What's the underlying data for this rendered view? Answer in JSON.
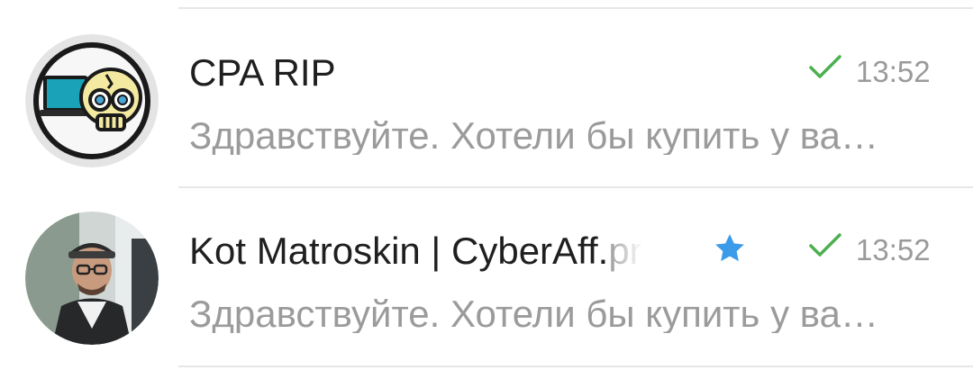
{
  "chats": [
    {
      "name": "CPA RIP",
      "avatar": "skull-laptop-logo",
      "status": "read-check-icon",
      "time": "13:52",
      "preview": "Здравствуйте.  Хотели бы купить у ва…"
    },
    {
      "name": "Kot Matroskin | CyberAff.",
      "name_fade": "pr",
      "badge": "star-icon",
      "avatar": "user-photo",
      "status": "read-check-icon",
      "time": "13:52",
      "preview": "Здравствуйте.  Хотели бы купить у ва…"
    }
  ],
  "colors": {
    "check": "#4caf50",
    "star": "#3b9be8",
    "time_text": "#9a9a9a",
    "preview_text": "#9b9b9b",
    "name_text": "#1f1f1f"
  }
}
